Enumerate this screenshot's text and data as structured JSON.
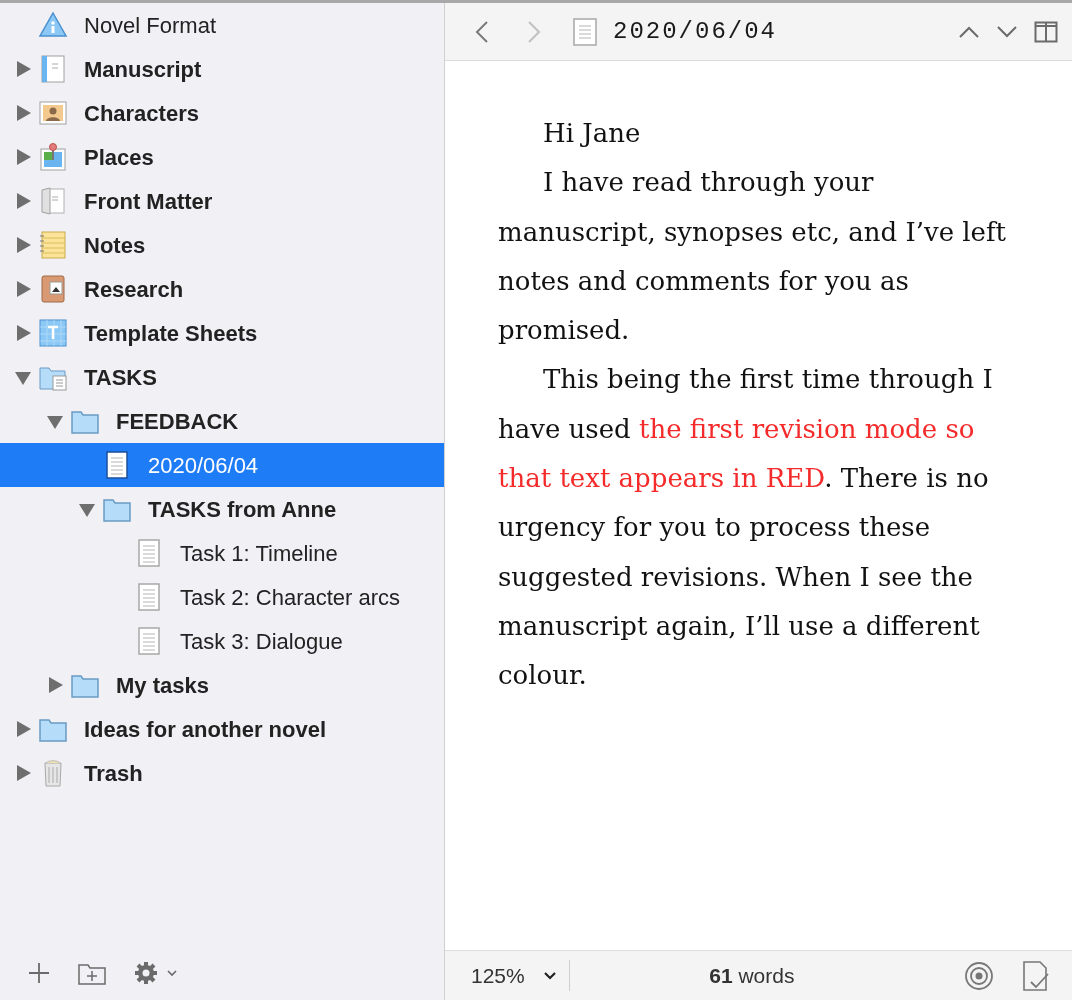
{
  "binder": [
    {
      "label": "Novel Format",
      "kind": "info"
    },
    {
      "label": "Manuscript",
      "kind": "manuscript",
      "expanded": false
    },
    {
      "label": "Characters",
      "kind": "characters",
      "expanded": false
    },
    {
      "label": "Places",
      "kind": "places",
      "expanded": false
    },
    {
      "label": "Front Matter",
      "kind": "frontmatter",
      "expanded": false
    },
    {
      "label": "Notes",
      "kind": "notes",
      "expanded": false
    },
    {
      "label": "Research",
      "kind": "research",
      "expanded": false
    },
    {
      "label": "Template Sheets",
      "kind": "template",
      "expanded": false
    },
    {
      "label": "TASKS",
      "kind": "tasks",
      "expanded": true,
      "children": [
        {
          "label": "FEEDBACK",
          "kind": "folder",
          "expanded": true,
          "children": [
            {
              "label": "2020/06/04",
              "kind": "document",
              "selected": true
            },
            {
              "label": "TASKS from Anne",
              "kind": "folder",
              "expanded": true,
              "children": [
                {
                  "label": "Task 1: Timeline",
                  "kind": "document",
                  "selected": false
                },
                {
                  "label": "Task 2: Character arcs",
                  "kind": "document",
                  "selected": false
                },
                {
                  "label": "Task 3: Dialogue",
                  "kind": "document",
                  "selected": false
                }
              ]
            }
          ]
        },
        {
          "label": "My tasks",
          "kind": "folder",
          "expanded": false
        }
      ]
    },
    {
      "label": "Ideas for another novel",
      "kind": "folder",
      "expanded": false
    },
    {
      "label": "Trash",
      "kind": "trash",
      "expanded": false
    }
  ],
  "editor": {
    "title": "2020/06/04",
    "paragraphs": [
      [
        {
          "text": "Hi Jane",
          "revised": false
        }
      ],
      [
        {
          "text": "I have read through your manuscript, synopses etc, and I’ve left notes and comments for you as promised.",
          "revised": false
        }
      ],
      [
        {
          "text": "This being the first time through I have used ",
          "revised": false
        },
        {
          "text": "the first revision mode so that text appears in RED",
          "revised": true
        },
        {
          "text": ". There is no urgency for you to process these suggested revisions. When I see the manuscript again, I’ll use a different colour.",
          "revised": false
        }
      ]
    ]
  },
  "footer": {
    "zoom": "125%",
    "word_count": "**61** words"
  }
}
